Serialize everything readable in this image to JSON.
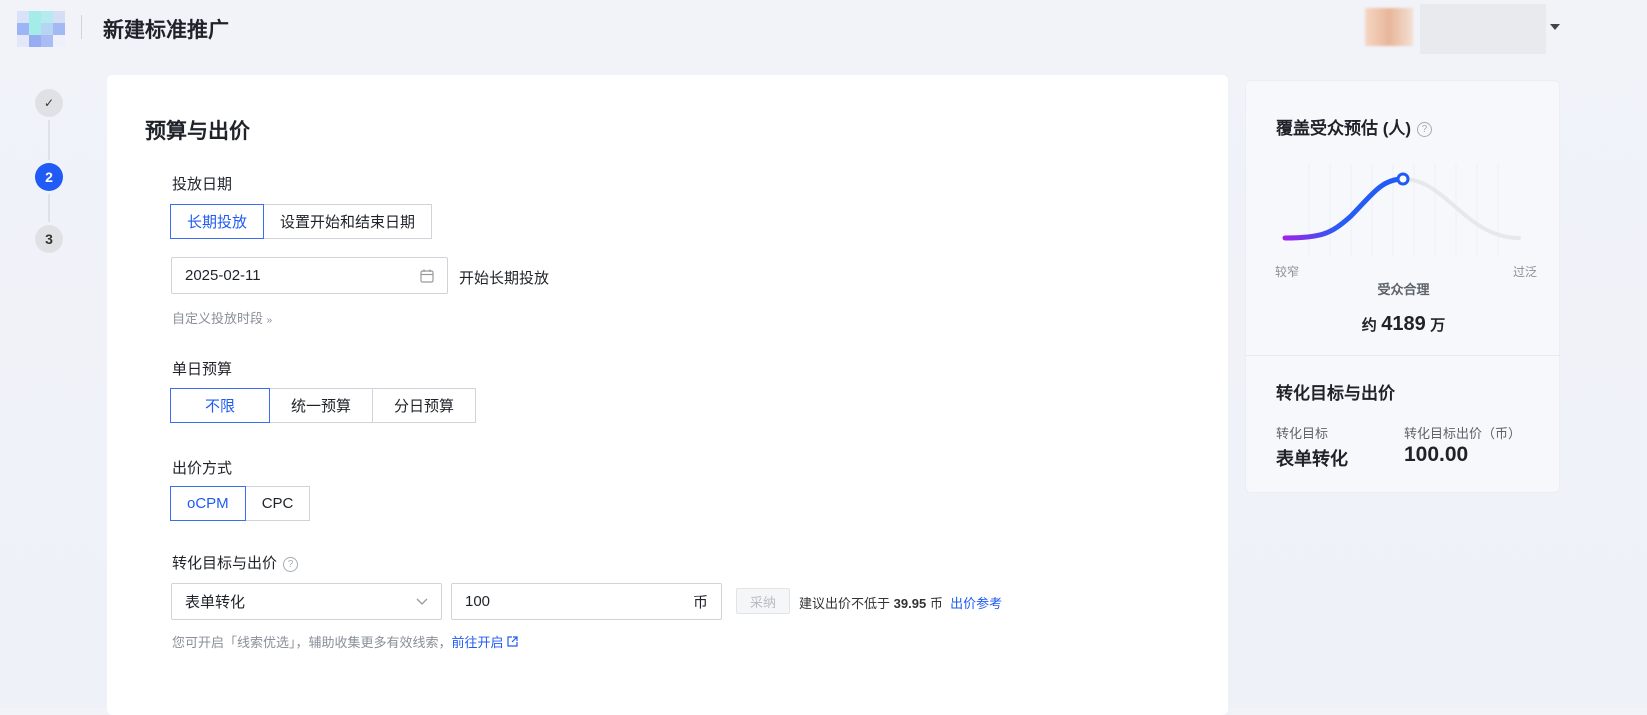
{
  "header": {
    "title": "新建标准推广"
  },
  "steps": [
    {
      "label": "✓",
      "state": "done"
    },
    {
      "label": "2",
      "state": "active"
    },
    {
      "label": "3",
      "state": "pending"
    }
  ],
  "section": {
    "title": "预算与出价"
  },
  "schedule": {
    "label": "投放日期",
    "options": [
      "长期投放",
      "设置开始和结束日期"
    ],
    "selected": "长期投放",
    "start_date": "2025-02-11",
    "suffix": "开始长期投放",
    "custom_link": "自定义投放时段"
  },
  "budget": {
    "label": "单日预算",
    "options": [
      "不限",
      "统一预算",
      "分日预算"
    ],
    "selected": "不限"
  },
  "bidding": {
    "label": "出价方式",
    "options": [
      "oCPM",
      "CPC"
    ],
    "selected": "oCPM"
  },
  "conversion": {
    "label": "转化目标与出价",
    "goal": "表单转化",
    "bid": "100",
    "unit": "币",
    "adopt_button": "采纳",
    "suggest_prefix": "建议出价不低于",
    "suggest_value": "39.95",
    "suggest_unit": "币",
    "reference_link": "出价参考",
    "tip": "您可开启「线索优选」，辅助收集更多有效线索，",
    "tip_link": "前往开启"
  },
  "estimate": {
    "title": "覆盖受众预估 (人)",
    "narrow_label": "较窄",
    "wide_label": "过泛",
    "status": "受众合理",
    "prefix": "约",
    "value": "4189",
    "unit": "万",
    "accent": "#1f5bf4"
  },
  "summary": {
    "title": "转化目标与出价",
    "goal_label": "转化目标",
    "goal_value": "表单转化",
    "bid_label": "转化目标出价（币）",
    "bid_value": "100.00"
  }
}
